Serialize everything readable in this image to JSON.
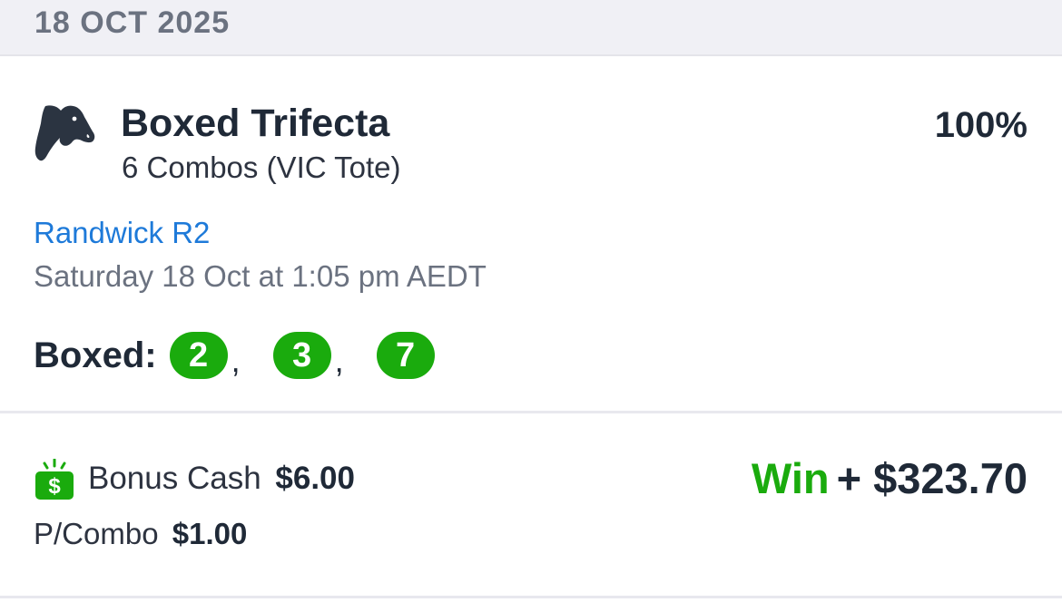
{
  "date_header": "18 OCT 2025",
  "bet": {
    "icon": "horse-head-icon",
    "title": "Boxed Trifecta",
    "subtitle": "6 Combos (VIC Tote)",
    "percent": "100%",
    "race": "Randwick R2",
    "race_time": "Saturday 18 Oct at 1:05 pm AEDT",
    "boxed_label": "Boxed:",
    "runners": [
      "2",
      "3",
      "7"
    ],
    "runner_separator": ",",
    "runner_color": "#1aab0d"
  },
  "stake": {
    "icon": "bonus-cash-icon",
    "bonus_label": "Bonus Cash",
    "bonus_amount": "$6.00",
    "combo_label": "P/Combo",
    "combo_amount": "$1.00",
    "result_label": "Win",
    "result_amount": "+ $323.70",
    "win_color": "#1aab0d"
  }
}
